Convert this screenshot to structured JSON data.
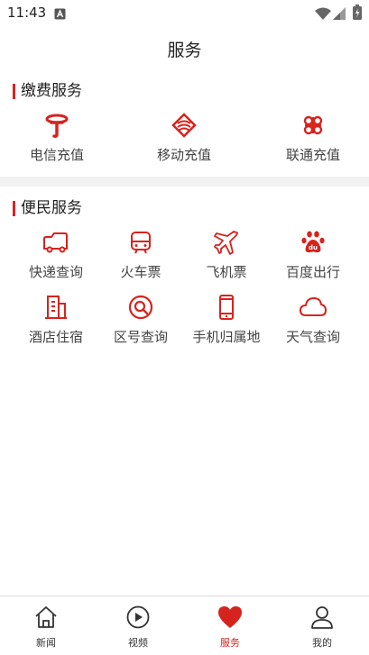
{
  "status_bar": {
    "time": "11:43"
  },
  "header": {
    "title": "服务"
  },
  "sections": {
    "payment": {
      "title": "缴费服务",
      "items": [
        {
          "label": "电信充值",
          "icon": "china-telecom-icon"
        },
        {
          "label": "移动充值",
          "icon": "china-mobile-icon"
        },
        {
          "label": "联通充值",
          "icon": "china-unicom-icon"
        }
      ]
    },
    "convenience": {
      "title": "便民服务",
      "items": [
        {
          "label": "快递查询",
          "icon": "delivery-truck-icon"
        },
        {
          "label": "火车票",
          "icon": "train-icon"
        },
        {
          "label": "飞机票",
          "icon": "airplane-icon"
        },
        {
          "label": "百度出行",
          "icon": "baidu-paw-icon"
        },
        {
          "label": "酒店住宿",
          "icon": "hotel-building-icon"
        },
        {
          "label": "区号查询",
          "icon": "search-icon"
        },
        {
          "label": "手机归属地",
          "icon": "mobile-phone-icon"
        },
        {
          "label": "天气查询",
          "icon": "cloud-icon"
        }
      ]
    }
  },
  "tab_bar": {
    "active": "服务",
    "tabs": [
      {
        "label": "新闻",
        "icon": "home-icon"
      },
      {
        "label": "视频",
        "icon": "play-icon"
      },
      {
        "label": "服务",
        "icon": "heart-icon"
      },
      {
        "label": "我的",
        "icon": "user-icon"
      }
    ]
  },
  "colors": {
    "accent": "#d7231e",
    "text": "#222222",
    "divider": "#f2f2f2"
  }
}
